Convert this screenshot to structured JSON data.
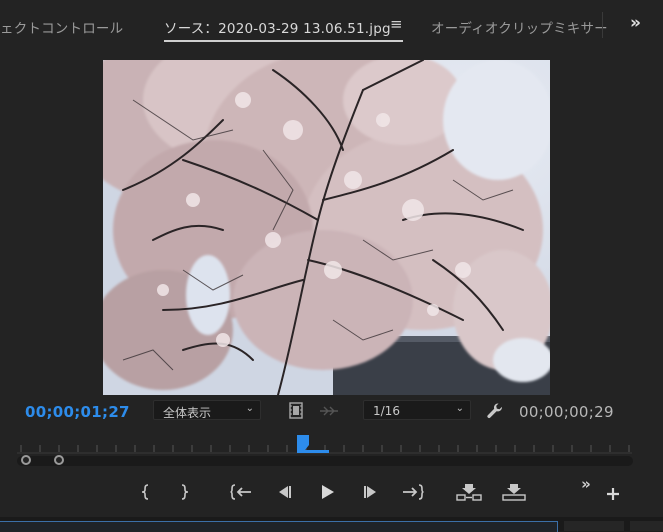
{
  "tabs": {
    "effect_controls": "ェクトコントロール",
    "source": "ソース：2020-03-29 13.06.51.jpg",
    "source_menu_icon": "hamburger-menu-icon",
    "audio_clip_mixer": "オーディオクリップミキサー",
    "overflow_icon": "double-chevron-right-icon"
  },
  "monitor": {
    "preview_image": "cherry-blossom-tree-photo",
    "playhead_timecode": "00;00;01;27",
    "zoom_dropdown": {
      "selected": "全体表示"
    },
    "resolution_dropdown": {
      "selected": "1/16"
    },
    "duration_timecode": "00;00;00;29",
    "settings_icon": "wrench-icon",
    "export_frame_icon": "film-frame-icon",
    "insert_icon": "insert-arrows-icon"
  },
  "transport": {
    "buttons": [
      {
        "name": "mark-in",
        "glyph": "{"
      },
      {
        "name": "mark-out",
        "glyph": "}"
      },
      {
        "name": "go-to-in",
        "glyph": "{←"
      },
      {
        "name": "step-back",
        "glyph": "◀|"
      },
      {
        "name": "play",
        "glyph": "▶"
      },
      {
        "name": "step-forward",
        "glyph": "|▶"
      },
      {
        "name": "go-to-out",
        "glyph": "→}"
      },
      {
        "name": "insert",
        "glyph": "insert"
      },
      {
        "name": "overwrite",
        "glyph": "overwrite"
      }
    ],
    "more_icon": "double-chevron-right-icon",
    "add_icon": "plus-icon"
  },
  "colors": {
    "accent": "#2d8ceb",
    "panel_bg": "#232323",
    "text": "#a8a8a8"
  }
}
